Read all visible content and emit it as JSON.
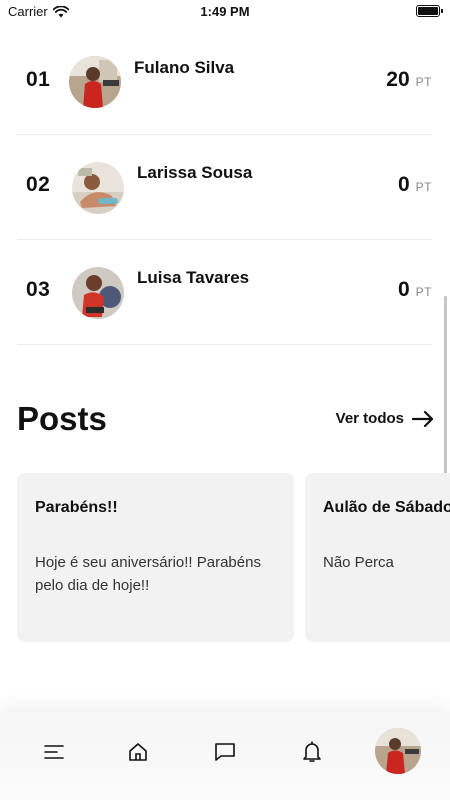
{
  "status_bar": {
    "carrier": "Carrier",
    "time": "1:49 PM",
    "battery_level": 1.0
  },
  "ranking": [
    {
      "position": "01",
      "name": "Fulano Silva",
      "points": "20",
      "unit": "PT"
    },
    {
      "position": "02",
      "name": "Larissa Sousa",
      "points": "0",
      "unit": "PT"
    },
    {
      "position": "03",
      "name": "Luisa Tavares",
      "points": "0",
      "unit": "PT"
    }
  ],
  "posts": {
    "title": "Posts",
    "see_all_label": "Ver todos",
    "items": [
      {
        "title": "Parabéns!!",
        "body": "Hoje é seu aniversário!! Parabéns pelo dia de hoje!!"
      },
      {
        "title": "Aulão de Sábado",
        "body": "Não Perca"
      }
    ]
  },
  "nav": {
    "items": [
      "menu-icon",
      "home-icon",
      "chat-icon",
      "bell-icon",
      "profile-avatar"
    ]
  },
  "colors": {
    "card_background": "#f2f2f2",
    "divider": "#ececec",
    "text": "#111111",
    "muted": "#888888"
  }
}
